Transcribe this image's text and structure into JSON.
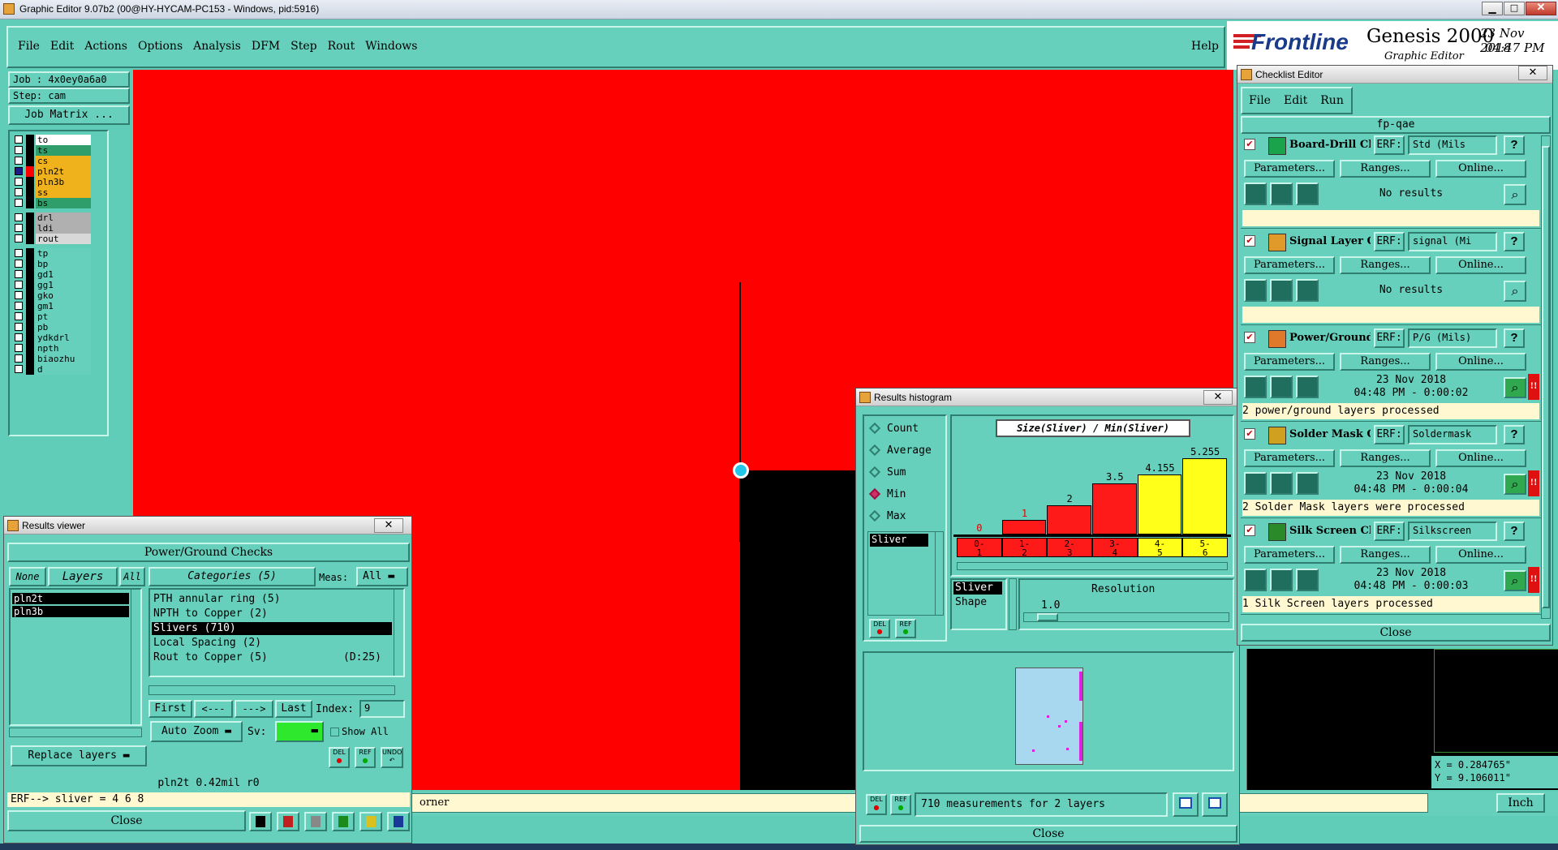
{
  "window": {
    "title": "Graphic Editor 9.07b2 (00@HY-HYCAM-PC153 - Windows, pid:5916)"
  },
  "menu": {
    "items": [
      "File",
      "Edit",
      "Actions",
      "Options",
      "Analysis",
      "DFM",
      "Step",
      "Rout",
      "Windows"
    ],
    "help": "Help"
  },
  "brand": {
    "logo": "Frontline",
    "product": "Genesis 2000",
    "subtitle": "Graphic Editor",
    "date": "23 Nov 2018",
    "time": "04:47 PM"
  },
  "job": {
    "job_label": "Job : 4x0ey0a6a0",
    "step_label": "Step: cam",
    "matrix_button": "Job Matrix ..."
  },
  "layers": {
    "group1": [
      {
        "name": "to",
        "color": "#ffffff"
      },
      {
        "name": "ts",
        "color": "#2f9e6a"
      },
      {
        "name": "cs",
        "color": "#f0b21c"
      },
      {
        "name": "pln2t",
        "color": "#f0b21c"
      },
      {
        "name": "pln3b",
        "color": "#f0b21c"
      },
      {
        "name": "ss",
        "color": "#f0b21c"
      },
      {
        "name": "bs",
        "color": "#2f9e6a"
      }
    ],
    "group2": [
      {
        "name": "drl",
        "color": "#b0b0b0"
      },
      {
        "name": "ldi",
        "color": "#b0b0b0"
      },
      {
        "name": "rout",
        "color": "#d8d8d8"
      }
    ],
    "group3": [
      {
        "name": "tp",
        "color": "#66d0bc"
      },
      {
        "name": "bp",
        "color": "#66d0bc"
      },
      {
        "name": "gd1",
        "color": "#66d0bc"
      },
      {
        "name": "gg1",
        "color": "#66d0bc"
      },
      {
        "name": "gko",
        "color": "#66d0bc"
      },
      {
        "name": "gm1",
        "color": "#66d0bc"
      },
      {
        "name": "pt",
        "color": "#66d0bc"
      },
      {
        "name": "pb",
        "color": "#66d0bc"
      },
      {
        "name": "ydkdrl",
        "color": "#66d0bc"
      },
      {
        "name": "npth",
        "color": "#66d0bc"
      },
      {
        "name": "biaozhu",
        "color": "#66d0bc"
      },
      {
        "name": "d",
        "color": "#66d0bc"
      }
    ]
  },
  "results_viewer": {
    "title": "Results viewer",
    "header": "Power/Ground Checks",
    "none": "None",
    "layers": "Layers",
    "all": "All",
    "layer_list": [
      "pln2t",
      "pln3b"
    ],
    "categories_label": "Categories (5)",
    "meas_label": "Meas:",
    "meas_value": "All",
    "categories": [
      {
        "text": "PTH annular ring (5)",
        "extra": ""
      },
      {
        "text": "NPTH to Copper (2)",
        "extra": ""
      },
      {
        "text": "Slivers (710)",
        "extra": ""
      },
      {
        "text": "Local Spacing (2)",
        "extra": ""
      },
      {
        "text": "Rout to Copper (5)",
        "extra": "(D:25)"
      }
    ],
    "first": "First",
    "prev": "<---",
    "next": "--->",
    "last": "Last",
    "index_label": "Index:",
    "index_value": "9",
    "auto_zoom": "Auto Zoom",
    "sv_label": "Sv:",
    "show_all": "Show All",
    "replace_layers": "Replace layers",
    "del": "DEL",
    "ref": "REF",
    "undo": "UNDO",
    "status": "pln2t 0.42mil  r0",
    "erf_line": "ERF--> sliver = 4 6 8",
    "close": "Close"
  },
  "statusbar": {
    "hint": "orner",
    "unit": "Inch",
    "x": "X = 0.284765\"",
    "y": "Y = 9.106011\""
  },
  "histogram": {
    "title": "Results histogram",
    "options": [
      "Count",
      "Average",
      "Sum",
      "Min",
      "Max"
    ],
    "selected_option": "Min",
    "list_item": "Sliver",
    "del": "DEL",
    "ref": "REF",
    "chart_title": "Size(Sliver) / Min(Sliver)",
    "sub_list": [
      "Sliver",
      "Shape"
    ],
    "resolution_label": "Resolution",
    "resolution_value": "1.0",
    "footer": "710 measurements for 2 layers",
    "close": "Close",
    "low_color": "#ff1a1a",
    "high_color": "#ffff1a"
  },
  "chart_data": {
    "type": "bar",
    "title": "Size(Sliver) / Min(Sliver)",
    "categories": [
      "0-1",
      "1-2",
      "2-3",
      "3-4",
      "4-5",
      "5-6"
    ],
    "category_labels": [
      [
        "0-",
        "1"
      ],
      [
        "1-",
        "2"
      ],
      [
        "2-",
        "3"
      ],
      [
        "3-",
        "4"
      ],
      [
        "4-",
        "5"
      ],
      [
        "5-",
        "6"
      ]
    ],
    "value_labels": [
      "0",
      "1",
      "2",
      "3.5",
      "4.155",
      "5.255"
    ],
    "values": [
      0,
      1,
      2,
      3.5,
      4.155,
      5.255
    ],
    "ylim": [
      0,
      5.255
    ]
  },
  "checklist": {
    "title": "Checklist Editor",
    "menu": [
      "File",
      "Edit",
      "Run"
    ],
    "name": "fp-qae",
    "params": "Parameters...",
    "ranges": "Ranges...",
    "online": "Online...",
    "erf_label": "ERF:",
    "close": "Close",
    "items": [
      {
        "name": "Board-Drill Che",
        "erf": "Std (Mils",
        "result_line1": "No results",
        "result_line2": "",
        "summary": "",
        "icon_color": "#1aa34a"
      },
      {
        "name": "Signal Layer Ch",
        "erf": "signal (Mi",
        "result_line1": "No results",
        "result_line2": "",
        "summary": "",
        "icon_color": "#e09a2a"
      },
      {
        "name": "Power/Ground C",
        "erf": "P/G (Mils)",
        "result_line1": "23 Nov 2018",
        "result_line2": "04:48 PM - 0:00:02",
        "summary": "2 power/ground layers processed",
        "icon_color": "#e07a2a"
      },
      {
        "name": "Solder Mask Ch",
        "erf": "Soldermask",
        "result_line1": "23 Nov 2018",
        "result_line2": "04:48 PM - 0:00:04",
        "summary": "2 Solder Mask layers were processed",
        "icon_color": "#d0a020"
      },
      {
        "name": "Silk Screen Che",
        "erf": "Silkscreen",
        "result_line1": "23 Nov 2018",
        "result_line2": "04:48 PM - 0:00:03",
        "summary": "1 Silk Screen layers processed",
        "icon_color": "#2a8a2a"
      }
    ]
  }
}
